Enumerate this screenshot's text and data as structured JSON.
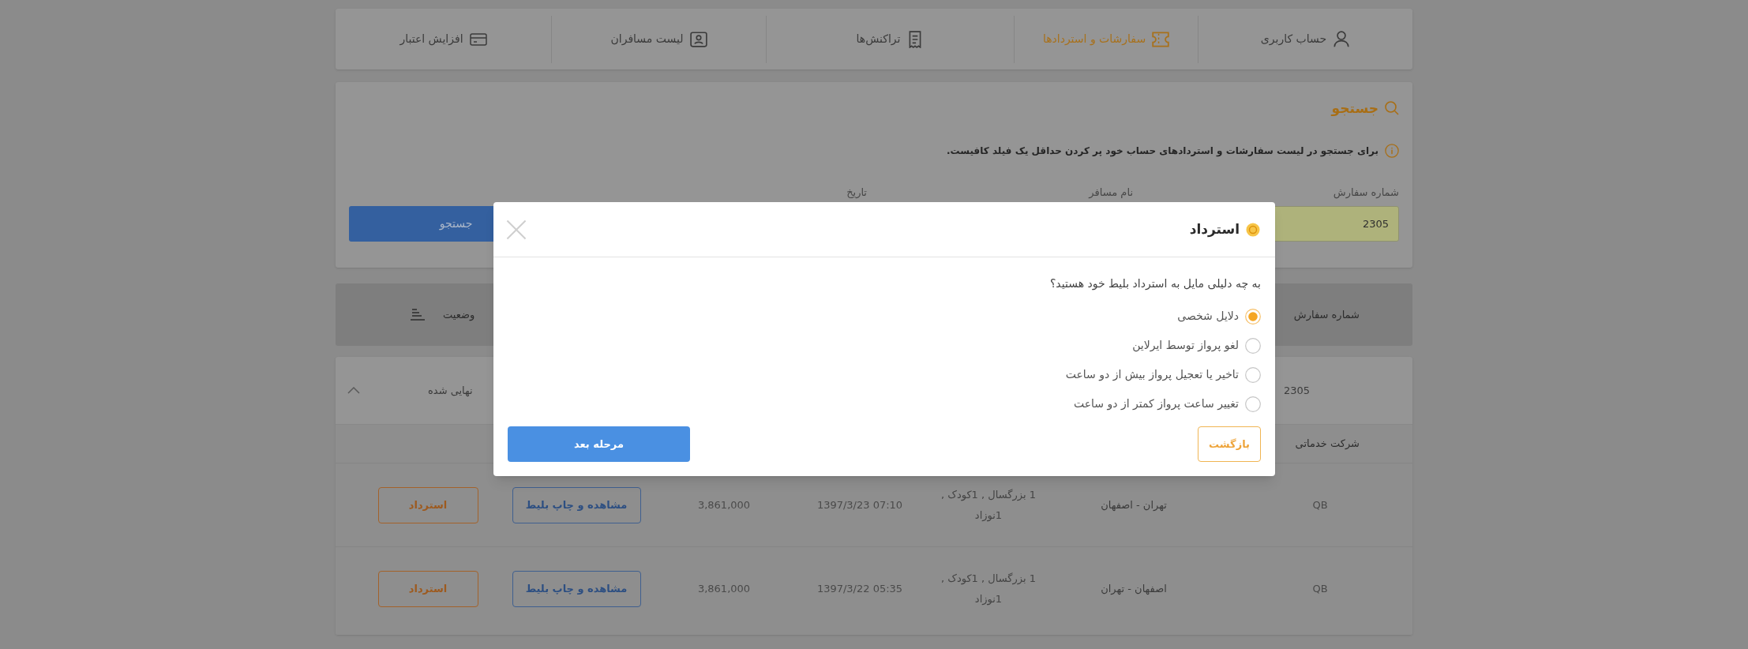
{
  "nav": [
    {
      "label": "حساب کاربری",
      "selected": false
    },
    {
      "label": "سفارشات و استردادها",
      "selected": true
    },
    {
      "label": "تراکنش‌ها",
      "selected": false
    },
    {
      "label": "لیست مسافران",
      "selected": false
    },
    {
      "label": "افزایش اعتبار",
      "selected": false
    }
  ],
  "search": {
    "title": "جستجو",
    "hint": "برای جستجو در لیست سفارشات و استردادهای حساب خود پر کردن حداقل یک فیلد کافیست.",
    "fields": [
      {
        "label": "شماره سفارش",
        "value": "2305"
      },
      {
        "label": "نام مسافر"
      },
      {
        "label": "تاریخ"
      }
    ],
    "button": "جستجو"
  },
  "table": {
    "columns": [
      {
        "label": "شماره سفارش",
        "sortable": false
      },
      {
        "label": "وضعیت",
        "sortable": true
      }
    ],
    "orders": [
      {
        "order_number": "2305",
        "status": "نهایی شده",
        "expanded": true,
        "ticket_columns": [
          "شرکت خدماتی"
        ],
        "tickets": [
          {
            "airline": "QB",
            "route": "تهران - اصفهان",
            "passengers": "1 بزرگسال , 1کودک , 1نوزاد",
            "datetime": "1397/3/23 07:10",
            "price": "3,861,000",
            "view_button": "مشاهده و چاپ بلیط",
            "refund_button": "استرداد"
          },
          {
            "airline": "QB",
            "route": "اصفهان - تهران",
            "passengers": "1 بزرگسال , 1کودک , 1نوزاد",
            "datetime": "1397/3/22 05:35",
            "price": "3,861,000",
            "view_button": "مشاهده و چاپ بلیط",
            "refund_button": "استرداد"
          }
        ]
      }
    ]
  },
  "dialog": {
    "title": "استرداد",
    "question": "به چه دلیلی مایل به استرداد بلیط خود هستید؟",
    "options": [
      {
        "label": "دلایل شخصی",
        "selected": true
      },
      {
        "label": "لغو پرواز توسط ایرلاین",
        "selected": false
      },
      {
        "label": "تاخیر یا تعجیل پرواز بیش از دو ساعت",
        "selected": false
      },
      {
        "label": "تغییر ساعت پرواز کمتر از دو ساعت",
        "selected": false
      }
    ],
    "back_button": "بازگشت",
    "next_button": "مرحله بعد"
  }
}
